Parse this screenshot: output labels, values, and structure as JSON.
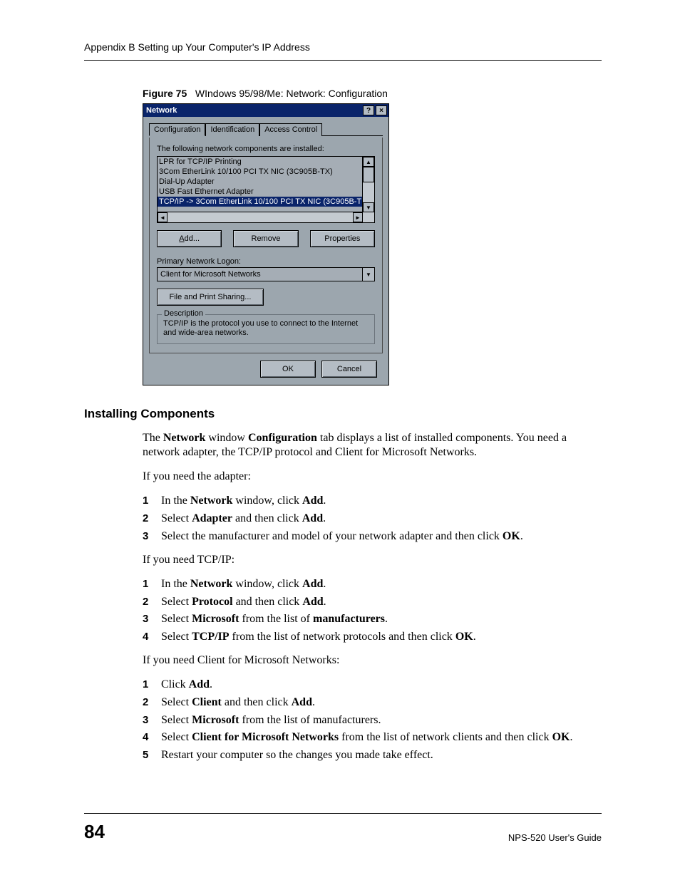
{
  "header": {
    "text": "Appendix B Setting up Your Computer's IP Address"
  },
  "figure": {
    "label": "Figure 75",
    "title": "WIndows 95/98/Me: Network: Configuration"
  },
  "dialog": {
    "title": "Network",
    "help_glyph": "?",
    "close_glyph": "×",
    "tabs": [
      "Configuration",
      "Identification",
      "Access Control"
    ],
    "active_tab": 0,
    "components_label": "The following network components are installed:",
    "components": [
      "LPR for TCP/IP Printing",
      "3Com EtherLink 10/100 PCI TX NIC (3C905B-TX)",
      "Dial-Up Adapter",
      "USB Fast Ethernet Adapter",
      "TCP/IP -> 3Com EtherLink 10/100 PCI TX NIC (3C905B-T"
    ],
    "selected_component": 4,
    "buttons": {
      "add": "Add...",
      "remove": "Remove",
      "properties": "Properties"
    },
    "logon_label": "Primary Network Logon:",
    "logon_value": "Client for Microsoft Networks",
    "file_print_sharing": "File and Print Sharing...",
    "description_legend": "Description",
    "description_text": "TCP/IP is the protocol you use to connect to the Internet and wide-area networks.",
    "ok": "OK",
    "cancel": "Cancel"
  },
  "section": {
    "heading": "Installing Components",
    "intro_parts": {
      "p1a": "The ",
      "p1b": "Network",
      "p1c": " window ",
      "p1d": "Configuration",
      "p1e": " tab displays a list of installed components. You need a network adapter, the TCP/IP protocol and Client for Microsoft Networks."
    },
    "adapter_lead": "If you need the adapter:",
    "adapter_steps": [
      {
        "a": "In the ",
        "b": "Network",
        "c": " window, click ",
        "d": "Add",
        "e": "."
      },
      {
        "a": "Select ",
        "b": "Adapter",
        "c": " and then click ",
        "d": "Add",
        "e": "."
      },
      {
        "a": "Select the manufacturer and model of your network adapter and then click ",
        "b": "OK",
        "c": "."
      }
    ],
    "tcpip_lead": "If you need TCP/IP:",
    "tcpip_steps": [
      {
        "a": "In the ",
        "b": "Network",
        "c": " window, click ",
        "d": "Add",
        "e": "."
      },
      {
        "a": "Select ",
        "b": "Protocol",
        "c": " and then click ",
        "d": "Add",
        "e": "."
      },
      {
        "a": "Select ",
        "b": "Microsoft",
        "c": " from the list of ",
        "d": "manufacturers",
        "e": "."
      },
      {
        "a": "Select ",
        "b": "TCP/IP",
        "c": " from the list of network protocols and then click ",
        "d": "OK",
        "e": "."
      }
    ],
    "client_lead": "If you need Client for Microsoft Networks:",
    "client_steps": [
      {
        "a": "Click ",
        "b": "Add",
        "c": "."
      },
      {
        "a": "Select ",
        "b": "Client",
        "c": " and then click ",
        "d": "Add",
        "e": "."
      },
      {
        "a": "Select ",
        "b": "Microsoft",
        "c": " from the list of manufacturers."
      },
      {
        "a": "Select ",
        "b": "Client for Microsoft Networks",
        "c": " from the list of network clients and then click ",
        "d": "OK",
        "e": "."
      },
      {
        "a": "Restart your computer so the changes you made take effect."
      }
    ]
  },
  "footer": {
    "page": "84",
    "guide": "NPS-520 User's Guide"
  }
}
